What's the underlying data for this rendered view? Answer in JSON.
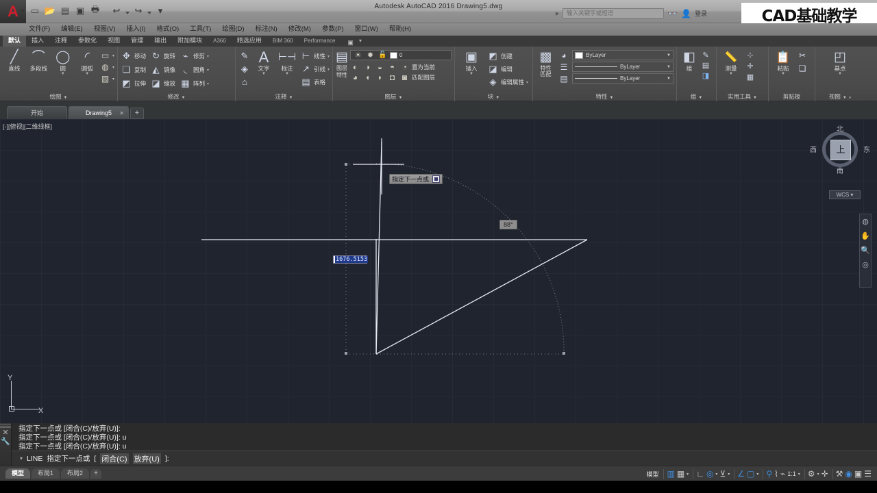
{
  "titlebar": {
    "app_logo": "A",
    "title": "Autodesk AutoCAD 2016      Drawing5.dwg",
    "quick_access": [
      {
        "name": "new",
        "glyph": "▭"
      },
      {
        "name": "open",
        "glyph": "📂"
      },
      {
        "name": "save",
        "glyph": "▤"
      },
      {
        "name": "saveas",
        "glyph": "▣"
      },
      {
        "name": "plot",
        "glyph": "🖶"
      },
      {
        "name": "undo",
        "glyph": "↩"
      },
      {
        "name": "redo",
        "glyph": "↪"
      },
      {
        "name": "customize",
        "glyph": "▾"
      }
    ],
    "search_placeholder": "输入关键字或短语",
    "signin_label": "登录",
    "watermark": "CAD基础教学"
  },
  "menubar": {
    "items": [
      {
        "label": "文件(F)"
      },
      {
        "label": "编辑(E)"
      },
      {
        "label": "视图(V)"
      },
      {
        "label": "插入(I)"
      },
      {
        "label": "格式(O)"
      },
      {
        "label": "工具(T)"
      },
      {
        "label": "绘图(D)"
      },
      {
        "label": "标注(N)"
      },
      {
        "label": "修改(M)"
      },
      {
        "label": "参数(P)"
      },
      {
        "label": "窗口(W)"
      },
      {
        "label": "帮助(H)"
      }
    ]
  },
  "ribbon_tabs": {
    "items": [
      {
        "label": "默认",
        "active": true
      },
      {
        "label": "插入",
        "active": false
      },
      {
        "label": "注释",
        "active": false
      },
      {
        "label": "参数化",
        "active": false
      },
      {
        "label": "视图",
        "active": false
      },
      {
        "label": "管理",
        "active": false
      },
      {
        "label": "输出",
        "active": false
      },
      {
        "label": "附加模块",
        "active": false
      },
      {
        "label": "A360",
        "active": false
      },
      {
        "label": "精选应用",
        "active": false
      },
      {
        "label": "BIM 360",
        "active": false
      },
      {
        "label": "Performance",
        "active": false
      }
    ],
    "camera_glyph": "▣"
  },
  "ribbon": {
    "draw": {
      "title": "绘图",
      "big": [
        {
          "label": "直线",
          "glyph": "╱",
          "dd": false
        },
        {
          "label": "多段线",
          "glyph": "⌒",
          "dd": false
        },
        {
          "label": "圆",
          "glyph": "◯",
          "dd": true
        },
        {
          "label": "圆弧",
          "glyph": "◜",
          "dd": true
        }
      ],
      "small": [
        {
          "glyph": "▭",
          "name": "rectangle"
        },
        {
          "glyph": "◍",
          "name": "hatch"
        },
        {
          "glyph": "▨",
          "name": "region"
        }
      ]
    },
    "modify": {
      "title": "修改",
      "items": [
        {
          "label": "移动",
          "glyph": "✥"
        },
        {
          "label": "旋转",
          "glyph": "↻"
        },
        {
          "label": "修剪",
          "glyph": "⌁"
        },
        {
          "label": "复制",
          "glyph": "❏"
        },
        {
          "label": "镜像",
          "glyph": "◭"
        },
        {
          "label": "圆角",
          "glyph": "◟"
        },
        {
          "label": "拉伸",
          "glyph": "◩"
        },
        {
          "label": "缩放",
          "glyph": "◪"
        },
        {
          "label": "阵列",
          "glyph": "▦"
        }
      ]
    },
    "annotation": {
      "title": "注释",
      "big": [
        {
          "label": "文字",
          "glyph": "A",
          "dd": true
        },
        {
          "label": "标注",
          "glyph": "⊢⊣",
          "dd": true
        }
      ],
      "small": [
        {
          "label": "线性",
          "glyph": "⊢"
        },
        {
          "label": "引线",
          "glyph": "↗"
        },
        {
          "label": "表格",
          "glyph": "▤"
        }
      ],
      "leftcol": [
        {
          "glyph": "✎",
          "name": "text-style"
        },
        {
          "glyph": "◈",
          "name": "dim-style"
        },
        {
          "glyph": "⌂",
          "name": "table-style"
        }
      ]
    },
    "layers": {
      "title": "图层",
      "main_label": "图层特性",
      "main_glyph": "▤",
      "layer_name": "0",
      "toggles": [
        {
          "glyph": "☀",
          "name": "layer-on"
        },
        {
          "glyph": "✹",
          "name": "layer-freeze"
        },
        {
          "glyph": "🔓",
          "name": "layer-lock"
        }
      ],
      "row1": [
        "置为当前"
      ],
      "row2": [
        "匹配图层"
      ]
    },
    "block": {
      "title": "块",
      "insert_label": "插入",
      "insert_glyph": "▣",
      "items": [
        {
          "label": "创建",
          "glyph": "◩"
        },
        {
          "label": "编辑",
          "glyph": "◪"
        },
        {
          "label": "编辑属性",
          "glyph": "◈"
        }
      ]
    },
    "properties": {
      "title": "特性",
      "match_label": "特性\n匹配",
      "combos": [
        {
          "type": "color",
          "value": "ByLayer"
        },
        {
          "type": "linetype",
          "value": "ByLayer"
        },
        {
          "type": "lineweight",
          "value": "ByLayer"
        }
      ]
    },
    "groups": {
      "title": "组",
      "label": "组",
      "glyph": "◧"
    },
    "utilities": {
      "title": "实用工具",
      "label": "测量",
      "glyph": "📏"
    },
    "clipboard": {
      "title": "剪贴板",
      "label": "粘贴",
      "glyph": "📋"
    },
    "view": {
      "title": "视图",
      "label": "基点",
      "glyph": "◰"
    }
  },
  "filetabs": {
    "items": [
      {
        "label": "开始",
        "active": false,
        "closable": false
      },
      {
        "label": "Drawing5",
        "active": true,
        "closable": true
      }
    ],
    "plus": "+"
  },
  "canvas": {
    "viewport_label": "[-][俯视][二维线框]",
    "viewcube": {
      "top": "上",
      "north": "北",
      "south": "南",
      "west": "西",
      "east": "东",
      "wcs": "WCS ▾"
    },
    "dynamic_prompt": "指定下一点或",
    "angle_value": "88°",
    "distance_value": "1676.5153",
    "ucs": {
      "x": "X",
      "y": "Y"
    }
  },
  "command": {
    "history": [
      {
        "text": "指定下一点或 [闭合(C)/放弃(U)]:"
      },
      {
        "text": "指定下一点或 [闭合(C)/放弃(U)]: u"
      },
      {
        "text": "指定下一点或 [闭合(C)/放弃(U)]: u"
      }
    ],
    "input": {
      "cmd": "LINE",
      "prompt": "指定下一点或",
      "open_bracket": "[",
      "opt1": "闭合(C)",
      "opt2": "放弃(U)",
      "close_bracket": "]:"
    }
  },
  "statusbar": {
    "layout_tabs": [
      {
        "label": "模型",
        "active": true
      },
      {
        "label": "布局1",
        "active": false
      },
      {
        "label": "布局2",
        "active": false
      }
    ],
    "layout_plus": "+",
    "model_label": "模型",
    "scale": "1:1",
    "icons": [
      {
        "name": "grid-display",
        "glyph": "▥",
        "on": true
      },
      {
        "name": "snap-mode",
        "glyph": "▦",
        "on": false
      },
      {
        "name": "ortho-mode",
        "glyph": "∟",
        "on": false
      },
      {
        "name": "polar-tracking",
        "glyph": "◎",
        "on": true
      },
      {
        "name": "object-snap",
        "glyph": "⊻",
        "on": false
      },
      {
        "name": "osnap-tracking",
        "glyph": "∠",
        "on": true
      },
      {
        "name": "ucs-icon",
        "glyph": "▢",
        "on": true
      },
      {
        "name": "dynamic-input",
        "glyph": "⚲",
        "on": true
      },
      {
        "name": "lineweight",
        "glyph": "⌇",
        "on": false
      },
      {
        "name": "transparency",
        "glyph": "⌁",
        "on": false
      },
      {
        "name": "annotation-scale",
        "glyph": "⚙",
        "on": false
      },
      {
        "name": "add-scale",
        "glyph": "✛",
        "on": false
      },
      {
        "name": "workspace",
        "glyph": "⚒",
        "on": false
      },
      {
        "name": "hardware-accel",
        "glyph": "◉",
        "on": true
      },
      {
        "name": "isolate-objects",
        "glyph": "▣",
        "on": false
      },
      {
        "name": "customization",
        "glyph": "☰",
        "on": false
      }
    ]
  }
}
